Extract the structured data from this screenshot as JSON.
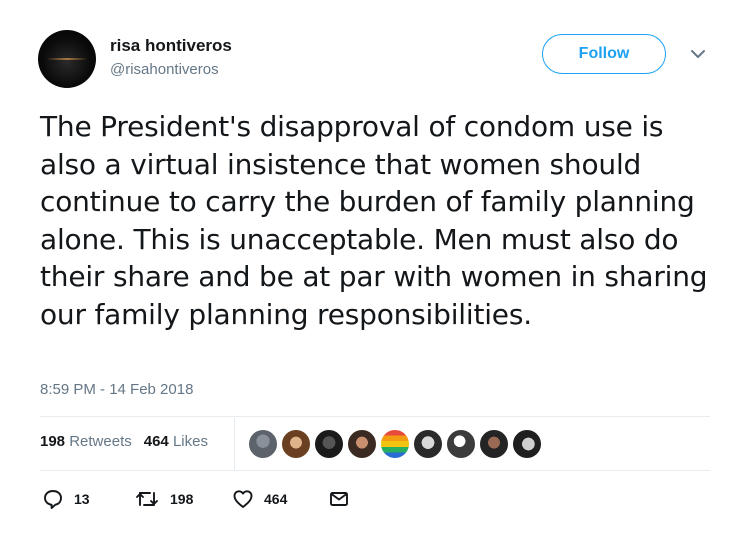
{
  "user": {
    "display_name": "risa hontiveros",
    "handle": "@risahontiveros"
  },
  "follow_label": "Follow",
  "tweet": {
    "text": "The President's disapproval of condom use is also a virtual insistence that women should continue to carry the burden of family planning alone. This is unacceptable. Men must also do their share and be at par with women in sharing our family planning responsibilities.",
    "timestamp": "8:59 PM - 14 Feb 2018"
  },
  "stats": {
    "retweets_count": "198",
    "retweets_label": "Retweets",
    "likes_count": "464",
    "likes_label": "Likes"
  },
  "actions": {
    "replies": "13",
    "retweets": "198",
    "likes": "464"
  },
  "icons": {
    "reply": "reply-icon",
    "retweet": "retweet-icon",
    "like": "heart-icon",
    "dm": "envelope-icon",
    "more": "chevron-down-icon"
  },
  "colors": {
    "accent": "#1da1f2",
    "text": "#14171a",
    "muted": "#657786"
  }
}
